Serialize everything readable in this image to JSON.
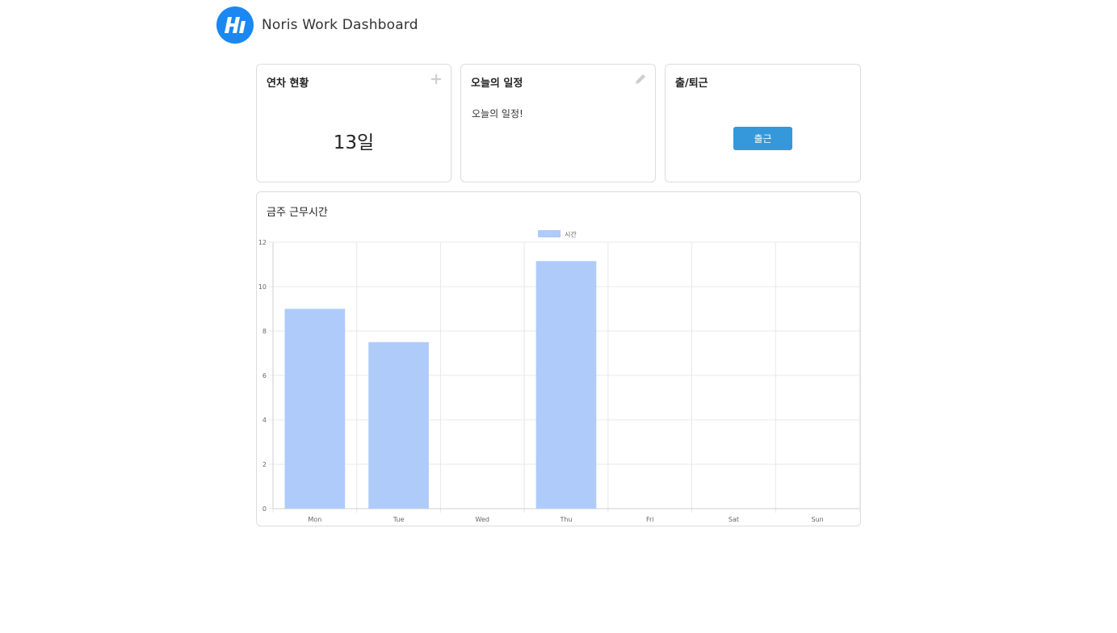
{
  "header": {
    "title": "Noris Work Dashboard",
    "logo_text": "Hi"
  },
  "leave_card": {
    "title": "연차 현황",
    "value": "13일",
    "action_icon": "plus-icon"
  },
  "schedule_card": {
    "title": "오늘의 일정",
    "text": "오늘의 일정!",
    "action_icon": "pencil-icon"
  },
  "attendance_card": {
    "title": "출/퇴근",
    "button_label": "출근"
  },
  "chart_card": {
    "title": "금주 근무시간"
  },
  "colors": {
    "accent": "#1a88f0",
    "button": "#3498db",
    "bar": "#aecbfa"
  },
  "chart_data": {
    "type": "bar",
    "title": "",
    "xlabel": "",
    "ylabel": "",
    "categories": [
      "Mon",
      "Tue",
      "Wed",
      "Thu",
      "Fri",
      "Sat",
      "Sun"
    ],
    "series": [
      {
        "name": "시간",
        "values": [
          9,
          7.5,
          0,
          11.15,
          0,
          0,
          0
        ]
      }
    ],
    "ylim": [
      0,
      12
    ],
    "yticks": [
      "0",
      "2",
      "4",
      "6",
      "8",
      "10",
      "12"
    ],
    "grid": true,
    "legend": "top-center"
  }
}
